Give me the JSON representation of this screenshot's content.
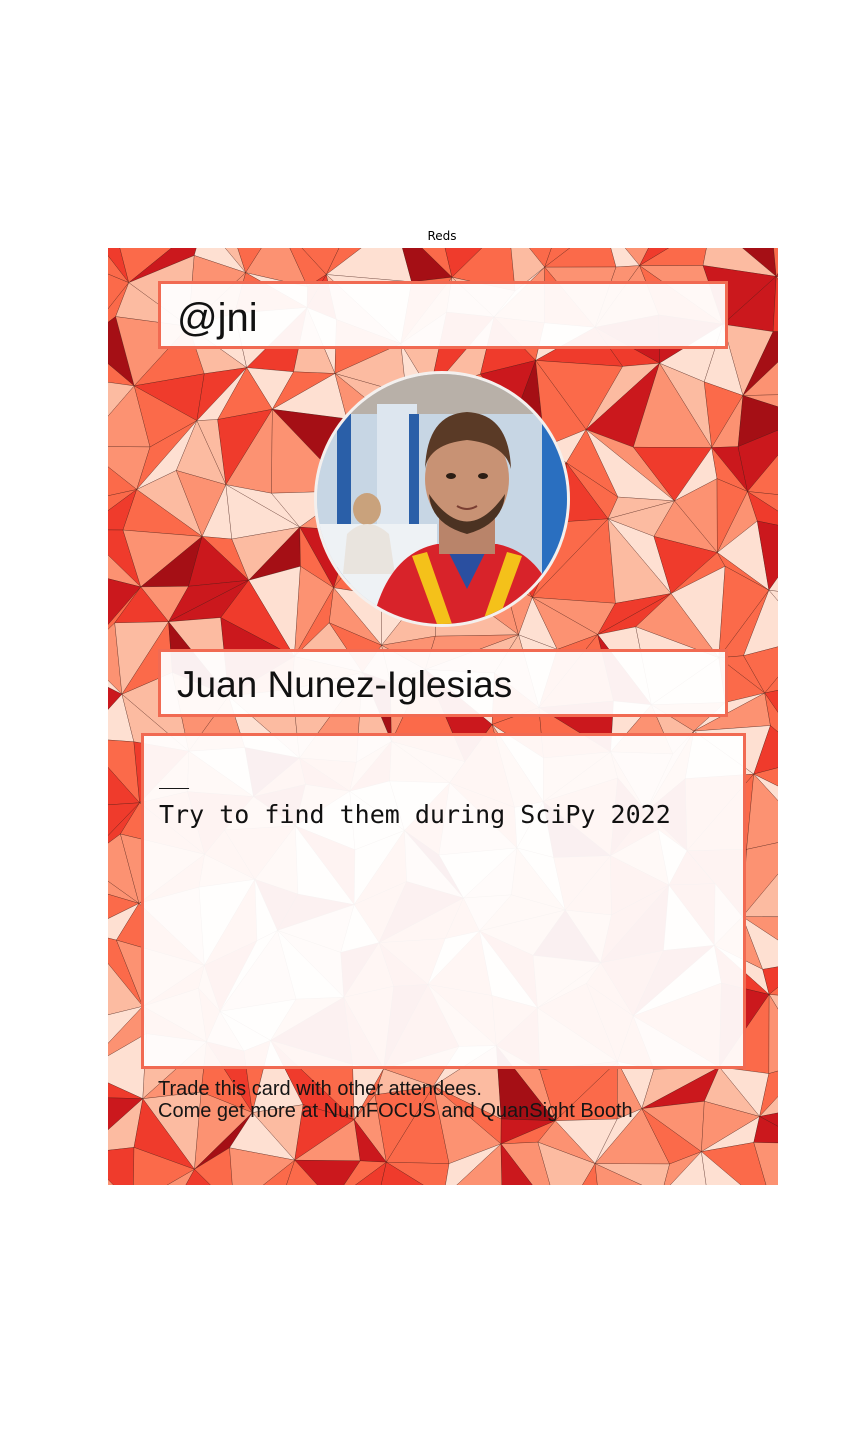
{
  "figure": {
    "title": "Reds"
  },
  "card": {
    "handle": "@jni",
    "name": "Juan Nunez-Iglesias",
    "bio_separator": "__",
    "bio_text": "Try to find them during SciPy 2022",
    "footer_line1": "Trade this card with other attendees.",
    "footer_line2": "Come get more at NumFOCUS and QuanSight Booth"
  },
  "theme": {
    "colormap": "Reds",
    "border_color": "#f16a52",
    "palette": [
      "#fee0d2",
      "#fcbba1",
      "#fc9272",
      "#fb6a4a",
      "#ef3b2c",
      "#cb181d",
      "#a50f15"
    ]
  }
}
